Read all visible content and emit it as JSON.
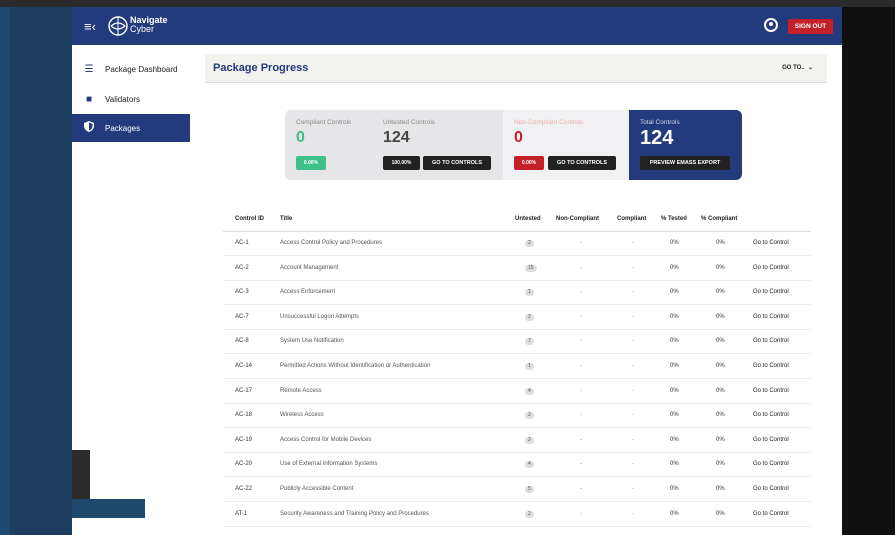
{
  "header": {
    "brand_name": "Navigate",
    "brand_sub": "Cyber",
    "sign_out": "SIGN OUT"
  },
  "sidebar": {
    "items": [
      {
        "label": "Package Dashboard",
        "icon": "list-icon"
      },
      {
        "label": "Validators",
        "icon": "book-icon"
      },
      {
        "label": "Packages",
        "icon": "shield-icon",
        "active": true
      }
    ]
  },
  "main": {
    "title": "Package Progress",
    "goto": "GO TO..",
    "stats": {
      "compliant": {
        "label": "Compliant Controls",
        "value": "0",
        "pct": "0.00%"
      },
      "untested": {
        "label": "Untested Controls",
        "value": "124",
        "pct": "100.00%",
        "button": "GO TO CONTROLS"
      },
      "noncompliant": {
        "label": "Non-Compliant Controls",
        "value": "0",
        "pct": "0.00%",
        "button": "GO TO CONTROLS"
      },
      "total": {
        "label": "Total Controls",
        "value": "124",
        "button": "PREVIEW EMASS EXPORT"
      }
    },
    "table": {
      "headers": [
        "Control ID",
        "Title",
        "Untested",
        "Non-Compliant",
        "Compliant",
        "% Tested",
        "% Compliant",
        ""
      ],
      "rows": [
        {
          "id": "AC-1",
          "title": "Access Control Policy and Procedures",
          "untested": "2",
          "noncompliant": "-",
          "compliant": "-",
          "tested": "0%",
          "pct_compliant": "0%",
          "action": "Go to Control"
        },
        {
          "id": "AC-2",
          "title": "Account Management",
          "untested": "15",
          "noncompliant": "-",
          "compliant": "-",
          "tested": "0%",
          "pct_compliant": "0%",
          "action": "Go to Control"
        },
        {
          "id": "AC-3",
          "title": "Access Enforcement",
          "untested": "1",
          "noncompliant": "-",
          "compliant": "-",
          "tested": "0%",
          "pct_compliant": "0%",
          "action": "Go to Control"
        },
        {
          "id": "AC-7",
          "title": "Unsuccessful Logon Attempts",
          "untested": "2",
          "noncompliant": "-",
          "compliant": "-",
          "tested": "0%",
          "pct_compliant": "0%",
          "action": "Go to Control"
        },
        {
          "id": "AC-8",
          "title": "System Use Notification",
          "untested": "7",
          "noncompliant": "-",
          "compliant": "-",
          "tested": "0%",
          "pct_compliant": "0%",
          "action": "Go to Control"
        },
        {
          "id": "AC-14",
          "title": "Permitted Actions Without Identification or Authentication",
          "untested": "1",
          "noncompliant": "-",
          "compliant": "-",
          "tested": "0%",
          "pct_compliant": "0%",
          "action": "Go to Control"
        },
        {
          "id": "AC-17",
          "title": "Remote Access",
          "untested": "4",
          "noncompliant": "-",
          "compliant": "-",
          "tested": "0%",
          "pct_compliant": "0%",
          "action": "Go to Control"
        },
        {
          "id": "AC-18",
          "title": "Wireless Access",
          "untested": "2",
          "noncompliant": "-",
          "compliant": "-",
          "tested": "0%",
          "pct_compliant": "0%",
          "action": "Go to Control"
        },
        {
          "id": "AC-19",
          "title": "Access Control for Mobile Devices",
          "untested": "2",
          "noncompliant": "-",
          "compliant": "-",
          "tested": "0%",
          "pct_compliant": "0%",
          "action": "Go to Control"
        },
        {
          "id": "AC-20",
          "title": "Use of External Information Systems",
          "untested": "4",
          "noncompliant": "-",
          "compliant": "-",
          "tested": "0%",
          "pct_compliant": "0%",
          "action": "Go to Control"
        },
        {
          "id": "AC-22",
          "title": "Publicly Accessible Content",
          "untested": "5",
          "noncompliant": "-",
          "compliant": "-",
          "tested": "0%",
          "pct_compliant": "0%",
          "action": "Go to Control"
        },
        {
          "id": "AT-1",
          "title": "Security Awareness and Training Policy and Procedures",
          "untested": "2",
          "noncompliant": "-",
          "compliant": "-",
          "tested": "0%",
          "pct_compliant": "0%",
          "action": "Go to Control"
        }
      ]
    }
  },
  "colors": {
    "navy": "#233a7c",
    "green": "#3fbf8a",
    "red": "#c4202a",
    "faded_red": "#f2a7ab"
  }
}
